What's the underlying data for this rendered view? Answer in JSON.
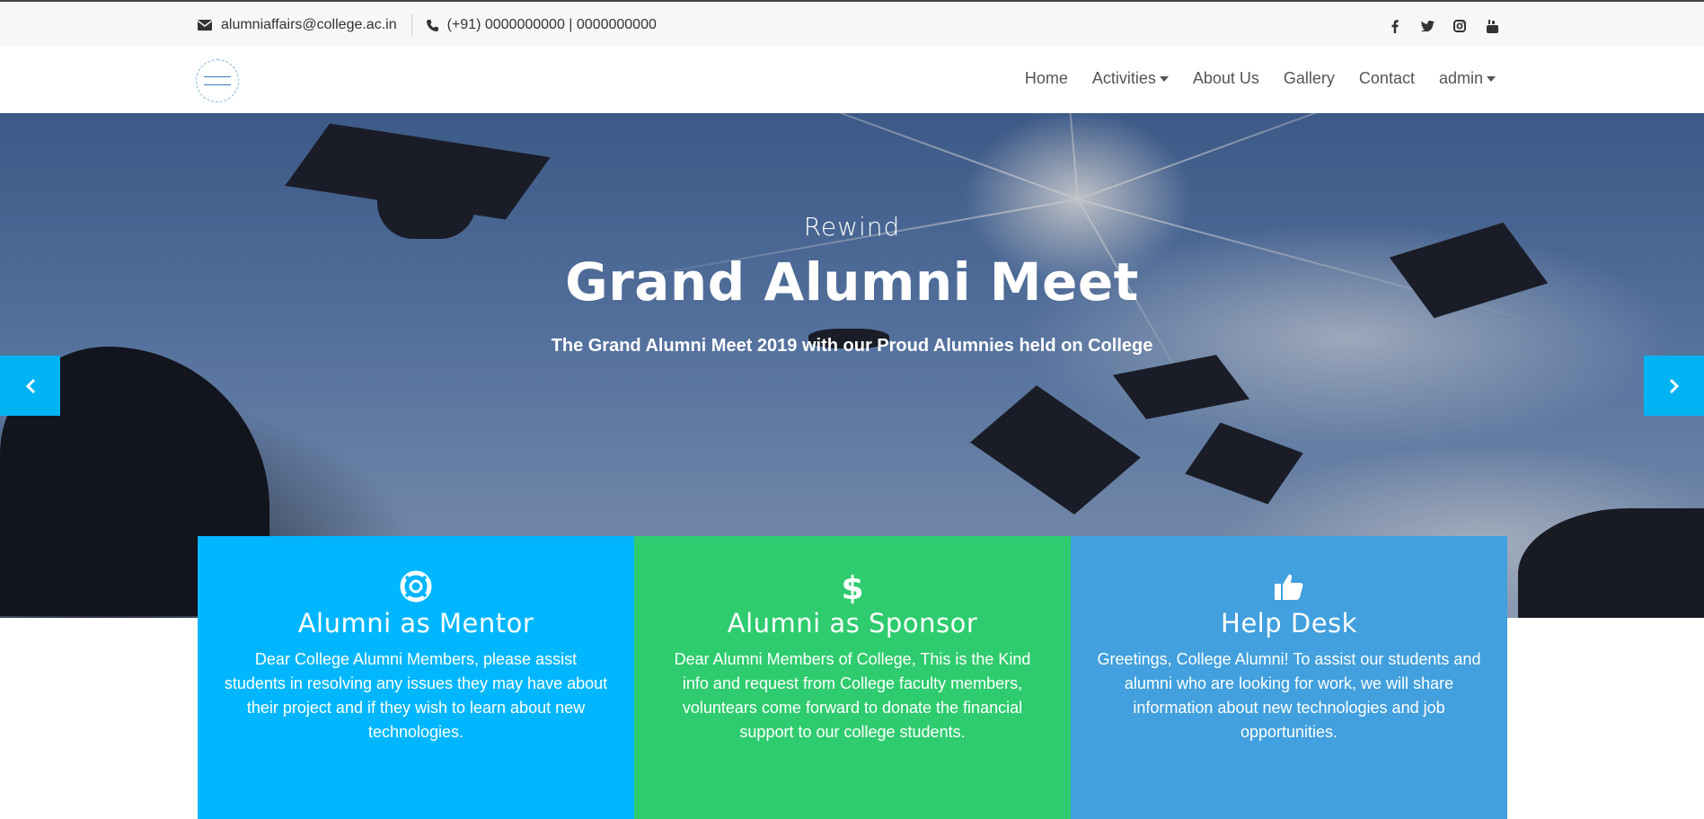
{
  "topbar": {
    "email": "alumniaffairs@college.ac.in",
    "phone": "(+91) 0000000000 | 0000000000",
    "social": [
      "facebook-icon",
      "twitter-icon",
      "instagram-icon",
      "youtube-icon"
    ]
  },
  "nav": {
    "items": [
      {
        "label": "Home",
        "dropdown": false
      },
      {
        "label": "Activities",
        "dropdown": true
      },
      {
        "label": "About Us",
        "dropdown": false
      },
      {
        "label": "Gallery",
        "dropdown": false
      },
      {
        "label": "Contact",
        "dropdown": false
      },
      {
        "label": "admin",
        "dropdown": true
      }
    ]
  },
  "hero": {
    "subtitle": "Rewind",
    "title": "Grand Alumni Meet",
    "description": "The Grand Alumni Meet 2019 with our Proud Alumnies held on College"
  },
  "features": [
    {
      "icon": "lifebuoy-icon",
      "title": "Alumni as Mentor",
      "text": "Dear College Alumni Members, please assist students in resolving any issues they may have about their project and if they wish to learn about new technologies.",
      "color": "#00b7ff"
    },
    {
      "icon": "dollar-icon",
      "title": "Alumni as Sponsor",
      "text": "Dear Alumni Members of College, This is the Kind info and request from College faculty members, voluntears come forward to donate the financial support to our college students.",
      "color": "#2ecc6e"
    },
    {
      "icon": "thumbs-up-icon",
      "title": "Help Desk",
      "text": "Greetings, College Alumni! To assist our students and alumni who are looking for work, we will share information about new technologies and job opportunities.",
      "color": "#41a0dd"
    }
  ],
  "colors": {
    "accent": "#00b3f3",
    "topbar_bg": "#f7f7f7"
  }
}
